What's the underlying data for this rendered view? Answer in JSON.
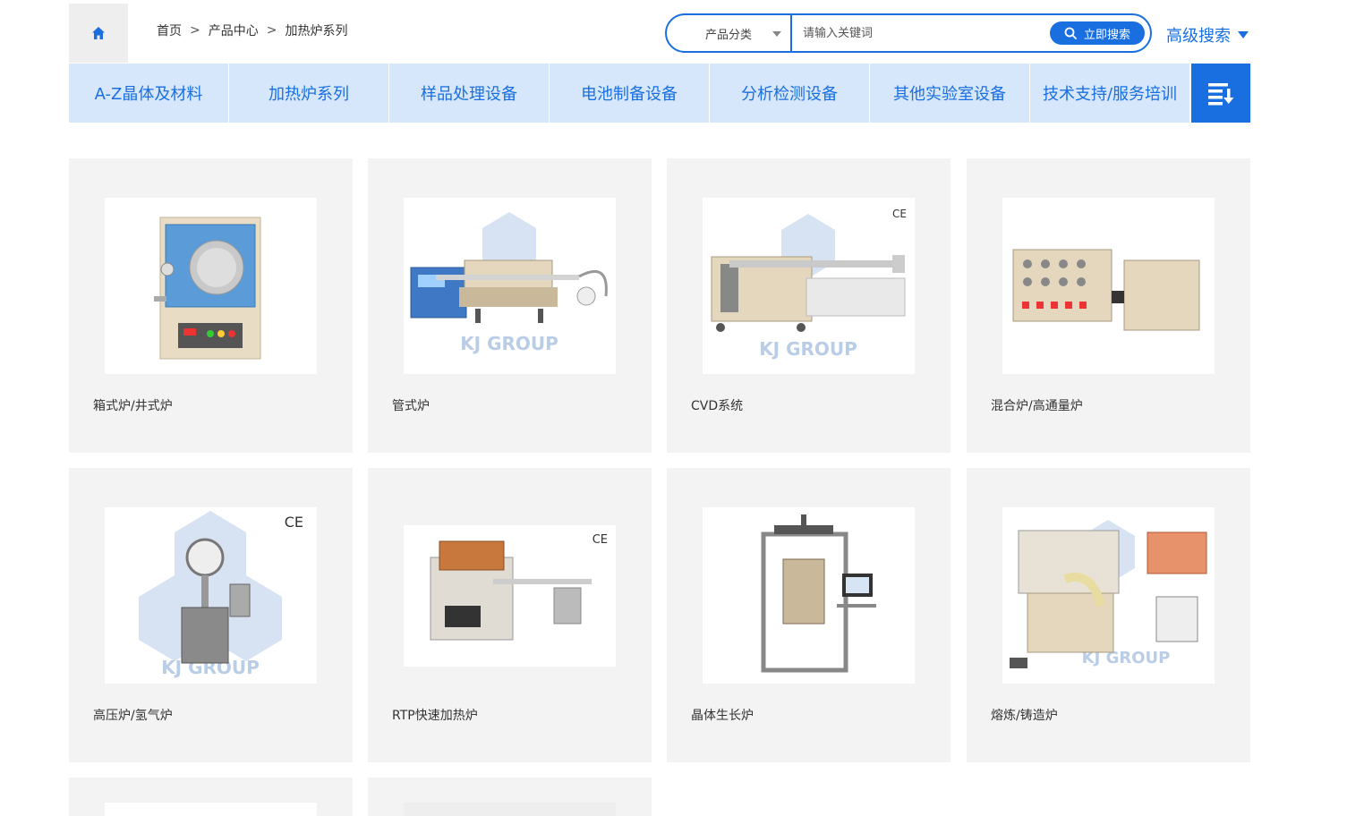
{
  "breadcrumb": {
    "items": [
      "首页",
      "产品中心",
      "加热炉系列"
    ],
    "separator": ">"
  },
  "search": {
    "category_label": "产品分类",
    "placeholder": "请输入关键词",
    "button_label": "立即搜索",
    "advanced_label": "高级搜索"
  },
  "nav": {
    "items": [
      "A-Z晶体及材料",
      "加热炉系列",
      "样品处理设备",
      "电池制备设备",
      "分析检测设备",
      "其他实验室设备",
      "技术支持/服务培训"
    ]
  },
  "products": [
    {
      "label": "箱式炉/井式炉"
    },
    {
      "label": "管式炉"
    },
    {
      "label": "CVD系统"
    },
    {
      "label": "混合炉/高通量炉"
    },
    {
      "label": "高压炉/氢气炉"
    },
    {
      "label": "RTP快速加热炉"
    },
    {
      "label": "晶体生长炉"
    },
    {
      "label": "熔炼/铸造炉"
    }
  ],
  "watermark": "KJ GROUP",
  "colors": {
    "accent": "#1a6fe0",
    "nav_bg": "#d7e7fb",
    "card_bg": "#f3f3f3"
  }
}
